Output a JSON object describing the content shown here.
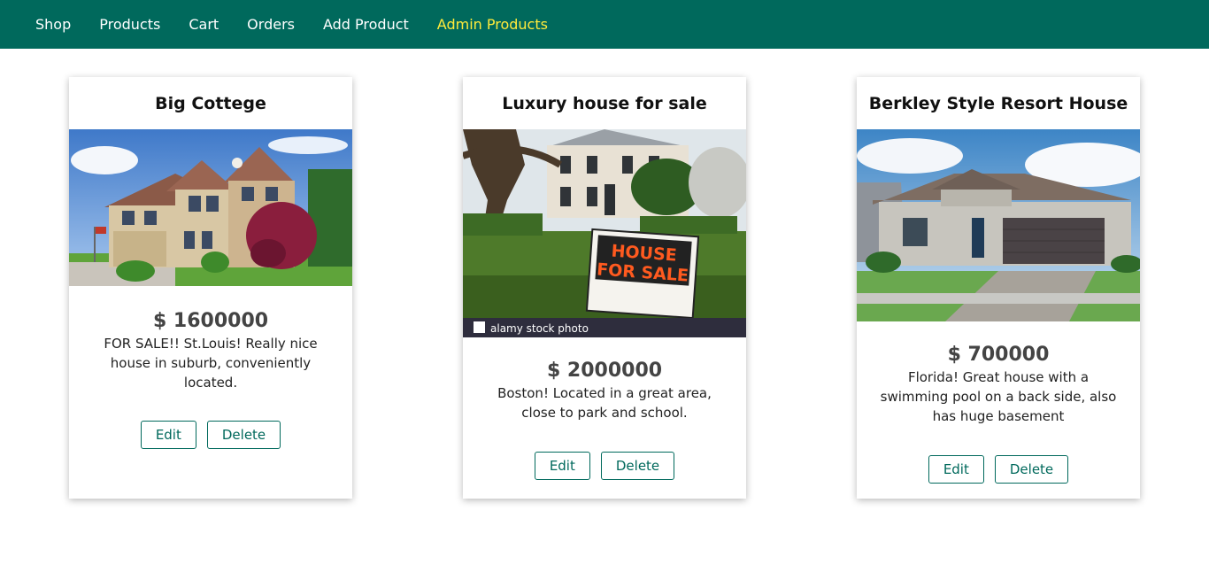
{
  "nav": {
    "items": [
      {
        "label": "Shop"
      },
      {
        "label": "Products"
      },
      {
        "label": "Cart"
      },
      {
        "label": "Orders"
      },
      {
        "label": "Add Product"
      },
      {
        "label": "Admin Products"
      }
    ],
    "active_color": "#ffeb3b",
    "bar_color": "#00695c"
  },
  "products": [
    {
      "title": "Big Cottege",
      "price": "$ 1600000",
      "description": "FOR SALE!! St.Louis! Really nice house in suburb, conveniently located.",
      "edit_label": "Edit",
      "delete_label": "Delete"
    },
    {
      "title": "Luxury house for sale",
      "price": "$ 2000000",
      "description": "Boston! Located in a great area, close to park and school.",
      "edit_label": "Edit",
      "delete_label": "Delete",
      "sign_text_1": "HOUSE",
      "sign_text_2": "FOR SALE",
      "watermark": "alamy stock photo"
    },
    {
      "title": "Berkley Style Resort House",
      "price": "$ 700000",
      "description": "Florida! Great house with a swimming pool on a back side, also has huge basement",
      "edit_label": "Edit",
      "delete_label": "Delete"
    }
  ]
}
